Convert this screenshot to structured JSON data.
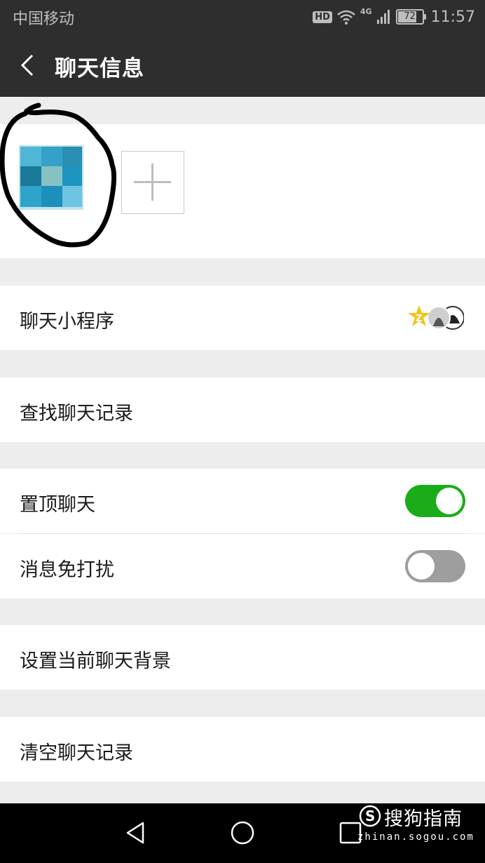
{
  "status_bar": {
    "carrier": "中国移动",
    "hd": "HD",
    "network": "4G",
    "battery": 72,
    "time": "11:57"
  },
  "header": {
    "title": "聊天信息"
  },
  "rows": {
    "mini_program": "聊天小程序",
    "search_history": "查找聊天记录",
    "pin_chat": "置顶聊天",
    "mute": "消息免打扰",
    "set_background": "设置当前聊天背景",
    "clear_history": "清空聊天记录"
  },
  "toggles": {
    "pin_chat": true,
    "mute": false
  },
  "colors": {
    "bar": "#2e2e2e",
    "toggle_on": "#1aad19",
    "toggle_off": "#9e9e9e",
    "page_bg": "#ededed"
  },
  "watermark": {
    "brand": "搜狗指南",
    "url": "zhinan.sogou.com"
  },
  "icons": [
    "back-arrow-icon",
    "add-member-icon",
    "wifi-icon",
    "signal-icon",
    "battery-icon",
    "mini-program-avatars",
    "nav-back-icon",
    "nav-home-icon",
    "nav-recents-icon"
  ]
}
